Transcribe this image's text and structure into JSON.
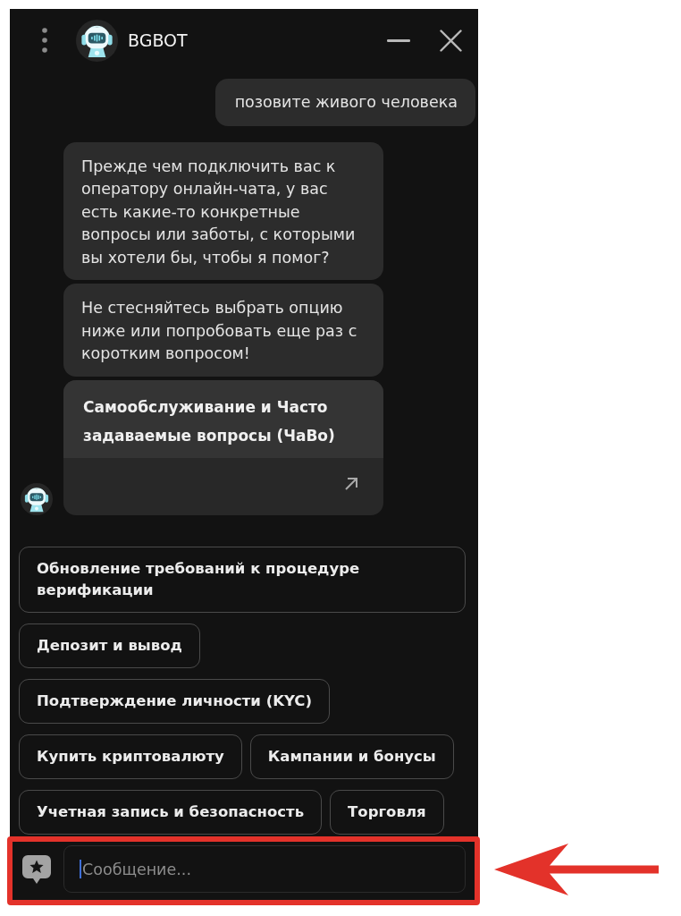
{
  "header": {
    "title": "BGBOT"
  },
  "messages": [
    {
      "outgoing": true,
      "kind": "text",
      "text": "позовите живого человека"
    },
    {
      "outgoing": false,
      "kind": "text",
      "text": "Прежде чем подключить вас к оператору онлайн-чата, у вас есть какие-то конкретные вопросы или заботы, с которыми вы хотели бы, чтобы я помог?"
    },
    {
      "outgoing": false,
      "kind": "text",
      "text": "Не стесняйтесь выбрать опцию ниже или попробовать еще раз с коротким вопросом!"
    },
    {
      "outgoing": false,
      "kind": "link_card",
      "title": "Самообслуживание и Часто задаваемые вопросы (ЧаВо)"
    }
  ],
  "quick_replies": [
    {
      "label": "Обновление требований к процедуре верификации"
    },
    {
      "label": "Депозит и вывод"
    },
    {
      "label": "Подтверждение личности (KYC)"
    },
    {
      "label": "Купить криптовалюту"
    },
    {
      "label": "Кампании и бонусы"
    },
    {
      "label": "Учетная запись и безопасность"
    },
    {
      "label": "Торговля"
    }
  ],
  "composer": {
    "placeholder": "Сообщение...",
    "focused": true
  },
  "annotation": {
    "frame": true,
    "arrow": true
  }
}
